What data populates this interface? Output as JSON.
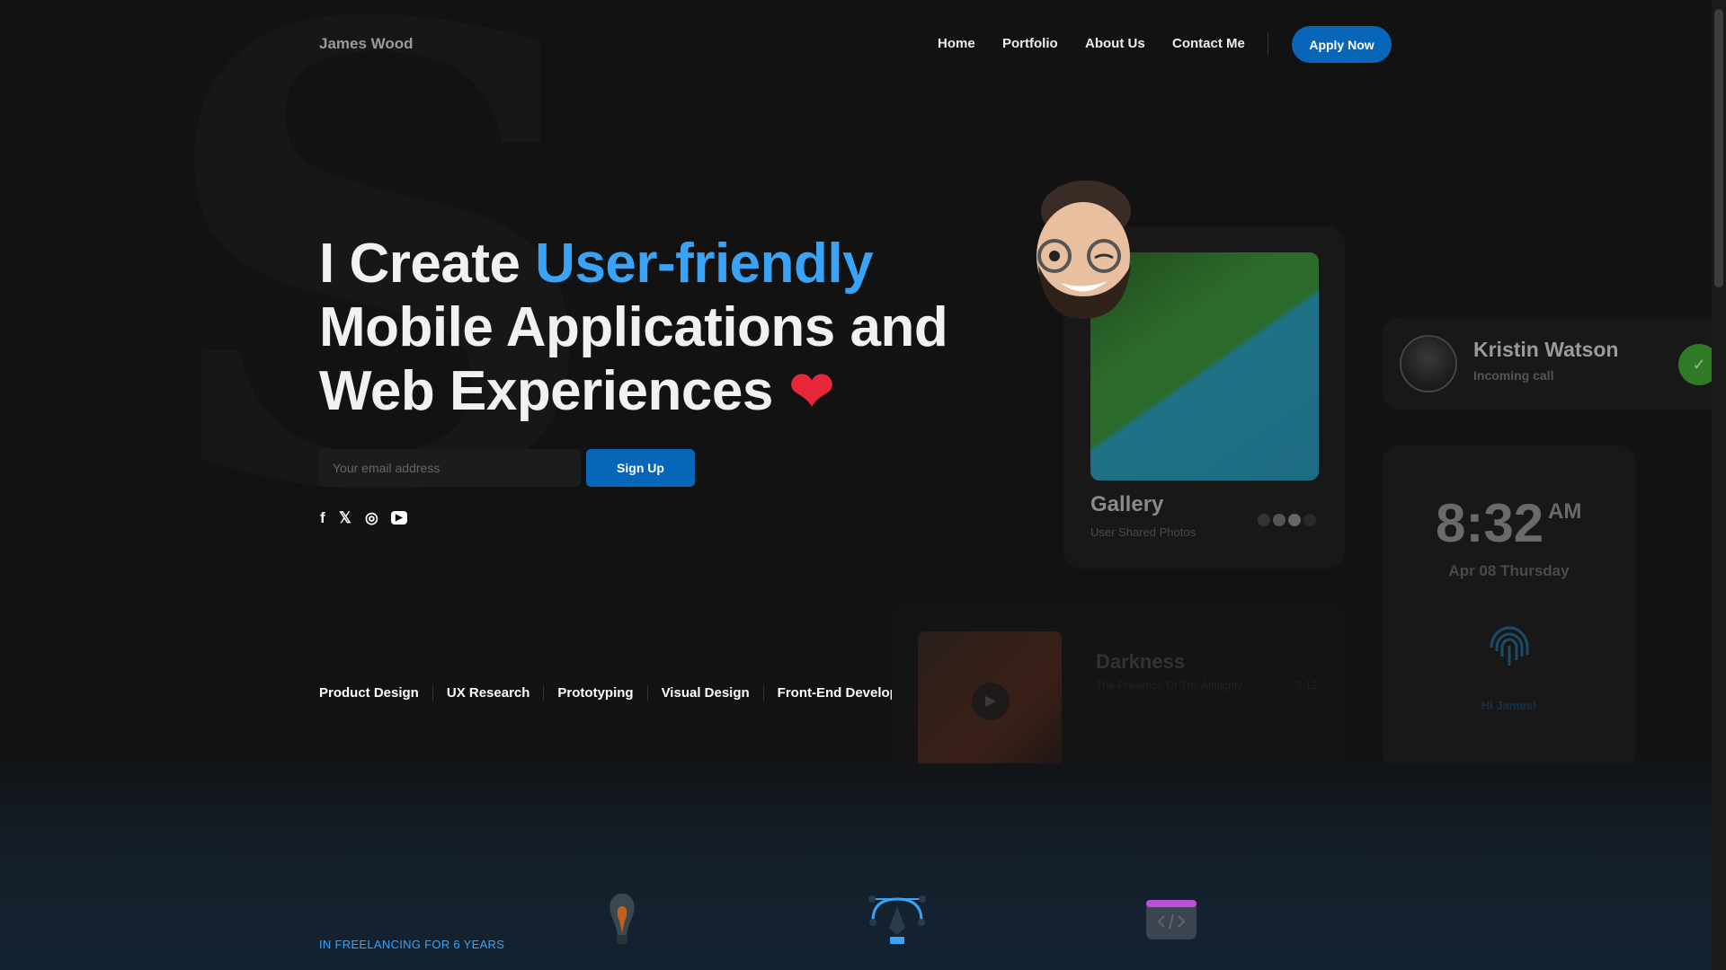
{
  "header": {
    "logo": "James Wood",
    "nav": [
      "Home",
      "Portfolio",
      "About Us",
      "Contact Me"
    ],
    "apply": "Apply Now"
  },
  "hero": {
    "line1_a": "I Create ",
    "line1_b": "User-friendly",
    "line2": "Mobile Applications and",
    "line3": "Web Experiences",
    "heart": "❤",
    "email_placeholder": "Your email address",
    "signup": "Sign Up",
    "social": [
      {
        "icon": "facebook-icon",
        "glyph": "f"
      },
      {
        "icon": "x-icon",
        "glyph": "𝕏"
      },
      {
        "icon": "instagram-icon",
        "glyph": "◎"
      },
      {
        "icon": "youtube-icon",
        "glyph": "▶"
      }
    ],
    "skills": [
      "Product Design",
      "UX Research",
      "Prototyping",
      "Visual Design",
      "Front-End Development"
    ]
  },
  "cards": {
    "gallery": {
      "title": "Gallery",
      "subtitle": "User Shared Photos"
    },
    "call": {
      "name": "Kristin Watson",
      "status": "Incoming call",
      "check": "✓"
    },
    "clock": {
      "time": "8:32",
      "ampm": "AM",
      "date": "Apr 08 Thursday",
      "greeting": "Hi James!"
    },
    "music": {
      "title": "Darkness",
      "artist": "The Presence Of The Almighty",
      "duration": "3:12"
    }
  },
  "bottom": {
    "tagline": "IN FREELANCING FOR 6 YEARS"
  },
  "colors": {
    "accent": "#3aa3f5",
    "button": "#0866b8",
    "bg": "#121212"
  }
}
